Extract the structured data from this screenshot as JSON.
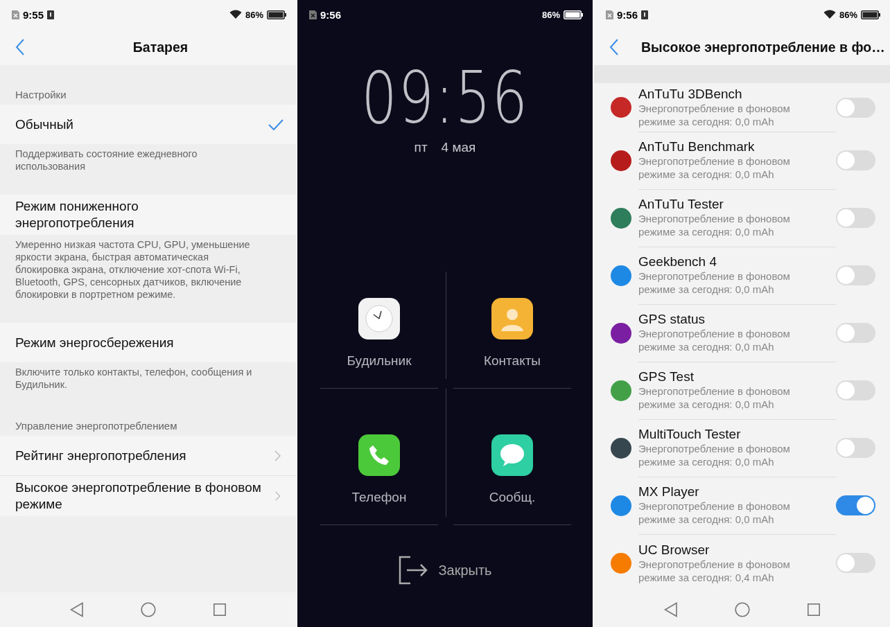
{
  "battery_screen": {
    "status_bar": {
      "time": "9:55",
      "battery": "86%",
      "wifi": true,
      "sd_card": true
    },
    "title": "Батарея",
    "items": [
      {
        "kind": "section",
        "text": "Настройки"
      },
      {
        "kind": "option",
        "text": "Обычный",
        "selected": true
      },
      {
        "kind": "description",
        "text": "Поддерживать состояние ежедневного использования"
      },
      {
        "kind": "option",
        "text": "Режим пониженного энергопотребления",
        "selected": false
      },
      {
        "kind": "description",
        "text": "Умеренно низкая частота CPU, GPU, уменьшение яркости экрана, быстрая автоматическая блокировка экрана, отключение хот-спота Wi-Fi, Bluetooth, GPS, сенсорных датчиков, включение блокировки в портретном режиме."
      },
      {
        "kind": "option",
        "text": "Режим энергосбережения",
        "selected": false
      },
      {
        "kind": "description",
        "text": "Включите только контакты, телефон, сообщения и Будильник."
      },
      {
        "kind": "section",
        "text": "Управление энергопотреблением"
      },
      {
        "kind": "link",
        "text": "Рейтинг энергопотребления"
      },
      {
        "kind": "link",
        "text": "Высокое энергопотребление в фоновом режиме"
      }
    ]
  },
  "lock_screen": {
    "status_bar": {
      "time": "9:56",
      "battery": "86%",
      "wifi": false,
      "sd_card": false
    },
    "clock": "09:56",
    "weekday": "пт",
    "date": "4 мая",
    "shortcuts": [
      {
        "label": "Будильник"
      },
      {
        "label": "Контакты"
      },
      {
        "label": "Телефон"
      },
      {
        "label": "Сообщ."
      }
    ],
    "close": "Закрыть"
  },
  "background_screen": {
    "status_bar": {
      "time": "9:56",
      "battery": "86%",
      "wifi": true,
      "sd_card": true
    },
    "title": "Высокое энергопотребление в фо…",
    "apps": [
      {
        "name": "AnTuTu 3DBench",
        "usage": "Энергопотребление в фоновом режиме за сегодня: 0,0 mAh",
        "on": false
      },
      {
        "name": "AnTuTu Benchmark",
        "usage": "Энергопотребление в фоновом режиме за сегодня: 0,0 mAh",
        "on": false
      },
      {
        "name": "AnTuTu Tester",
        "usage": "Энергопотребление в фоновом режиме за сегодня: 0,0 mAh",
        "on": false
      },
      {
        "name": "Geekbench 4",
        "usage": "Энергопотребление в фоновом режиме за сегодня: 0,0 mAh",
        "on": false
      },
      {
        "name": "GPS status",
        "usage": "Энергопотребление в фоновом режиме за сегодня: 0,0 mAh",
        "on": false
      },
      {
        "name": "GPS Test",
        "usage": "Энергопотребление в фоновом режиме за сегодня: 0,0 mAh",
        "on": false
      },
      {
        "name": "MultiTouch Tester",
        "usage": "Энергопотребление в фоновом режиме за сегодня: 0,0 mAh",
        "on": false
      },
      {
        "name": "MX Player",
        "usage": "Энергопотребление в фоновом режиме за сегодня: 0,0 mAh",
        "on": true
      },
      {
        "name": "UC Browser",
        "usage": "Энергопотребление в фоновом режиме за сегодня: 0,4 mAh",
        "on": false
      }
    ]
  }
}
